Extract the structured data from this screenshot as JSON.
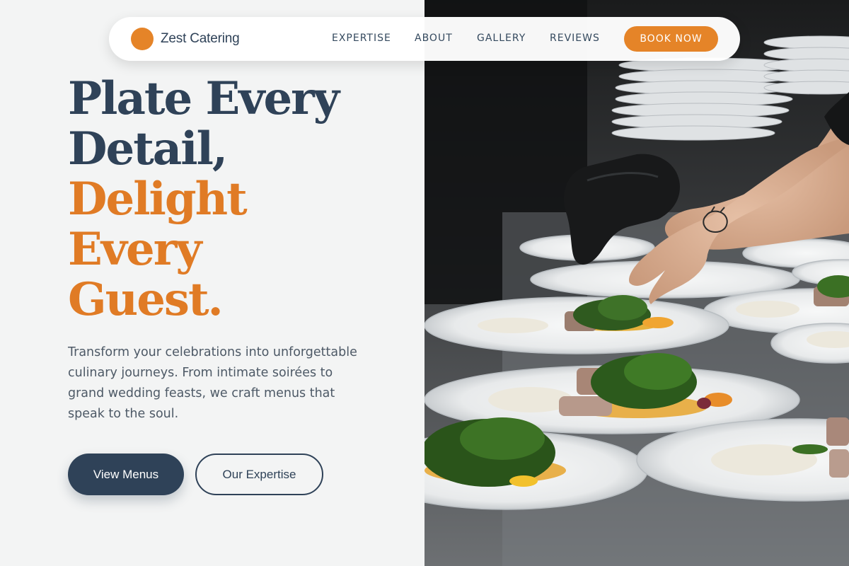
{
  "brand": {
    "name": "Zest Catering",
    "accent": "#e58428"
  },
  "nav": {
    "links": [
      "EXPERTISE",
      "ABOUT",
      "GALLERY",
      "REVIEWS"
    ],
    "cta": "BOOK NOW"
  },
  "hero": {
    "line1": "Plate Every",
    "line2": "Detail,",
    "line3": "Delight",
    "line4": "Every",
    "line5": "Guest.",
    "description": "Transform your celebrations into unforgettable culinary journeys. From intimate soirées to grand wedding feasts, we craft menus that speak to the soul.",
    "primary_button": "View Menus",
    "secondary_button": "Our Expertise"
  },
  "colors": {
    "dark": "#2f4258",
    "orange": "#e07b25",
    "background": "#f3f4f4"
  },
  "image": {
    "icon": "plated-food-photo"
  }
}
